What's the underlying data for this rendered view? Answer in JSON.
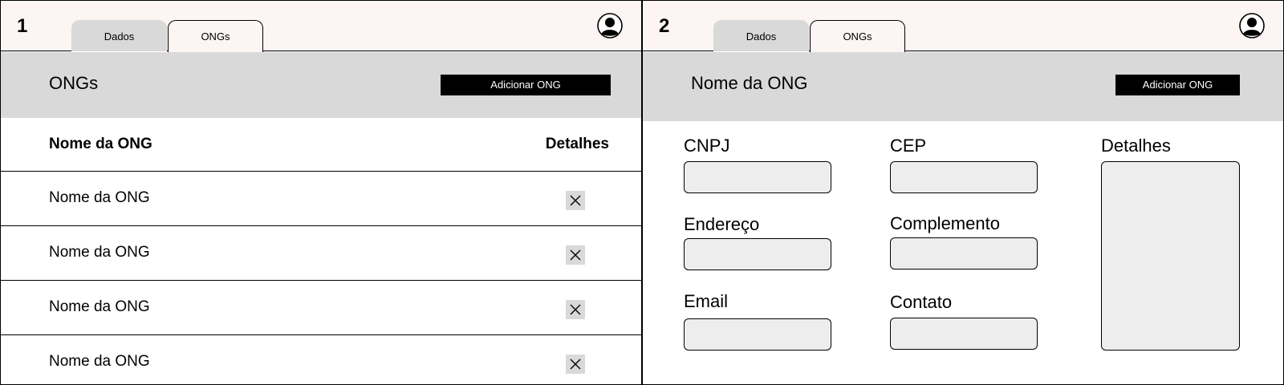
{
  "screens": [
    {
      "number": "1",
      "tabs": [
        {
          "label": "Dados",
          "active": false
        },
        {
          "label": "ONGs",
          "active": true
        }
      ],
      "header_title": "ONGs",
      "add_button_label": "Adicionar ONG",
      "table": {
        "columns": [
          "Nome da ONG",
          "Detalhes"
        ],
        "rows": [
          {
            "name": "Nome da ONG"
          },
          {
            "name": "Nome da ONG"
          },
          {
            "name": "Nome da ONG"
          },
          {
            "name": "Nome da ONG"
          }
        ]
      }
    },
    {
      "number": "2",
      "tabs": [
        {
          "label": "Dados",
          "active": false
        },
        {
          "label": "ONGs",
          "active": true
        }
      ],
      "header_title": "Nome da ONG",
      "add_button_label": "Adicionar ONG",
      "form": {
        "fields": [
          {
            "label": "CNPJ",
            "value": ""
          },
          {
            "label": "CEP",
            "value": ""
          },
          {
            "label": "Endereço",
            "value": ""
          },
          {
            "label": "Complemento",
            "value": ""
          },
          {
            "label": "Email",
            "value": ""
          },
          {
            "label": "Contato",
            "value": ""
          }
        ],
        "details_label": "Detalhes",
        "details_value": ""
      }
    }
  ],
  "icons": {
    "avatar": "user-avatar-icon",
    "remove": "close-icon"
  },
  "colors": {
    "topbar": "#fdf4f4",
    "header_band": "#d9d9d9",
    "button": "#000000",
    "input_fill": "#ededed"
  }
}
